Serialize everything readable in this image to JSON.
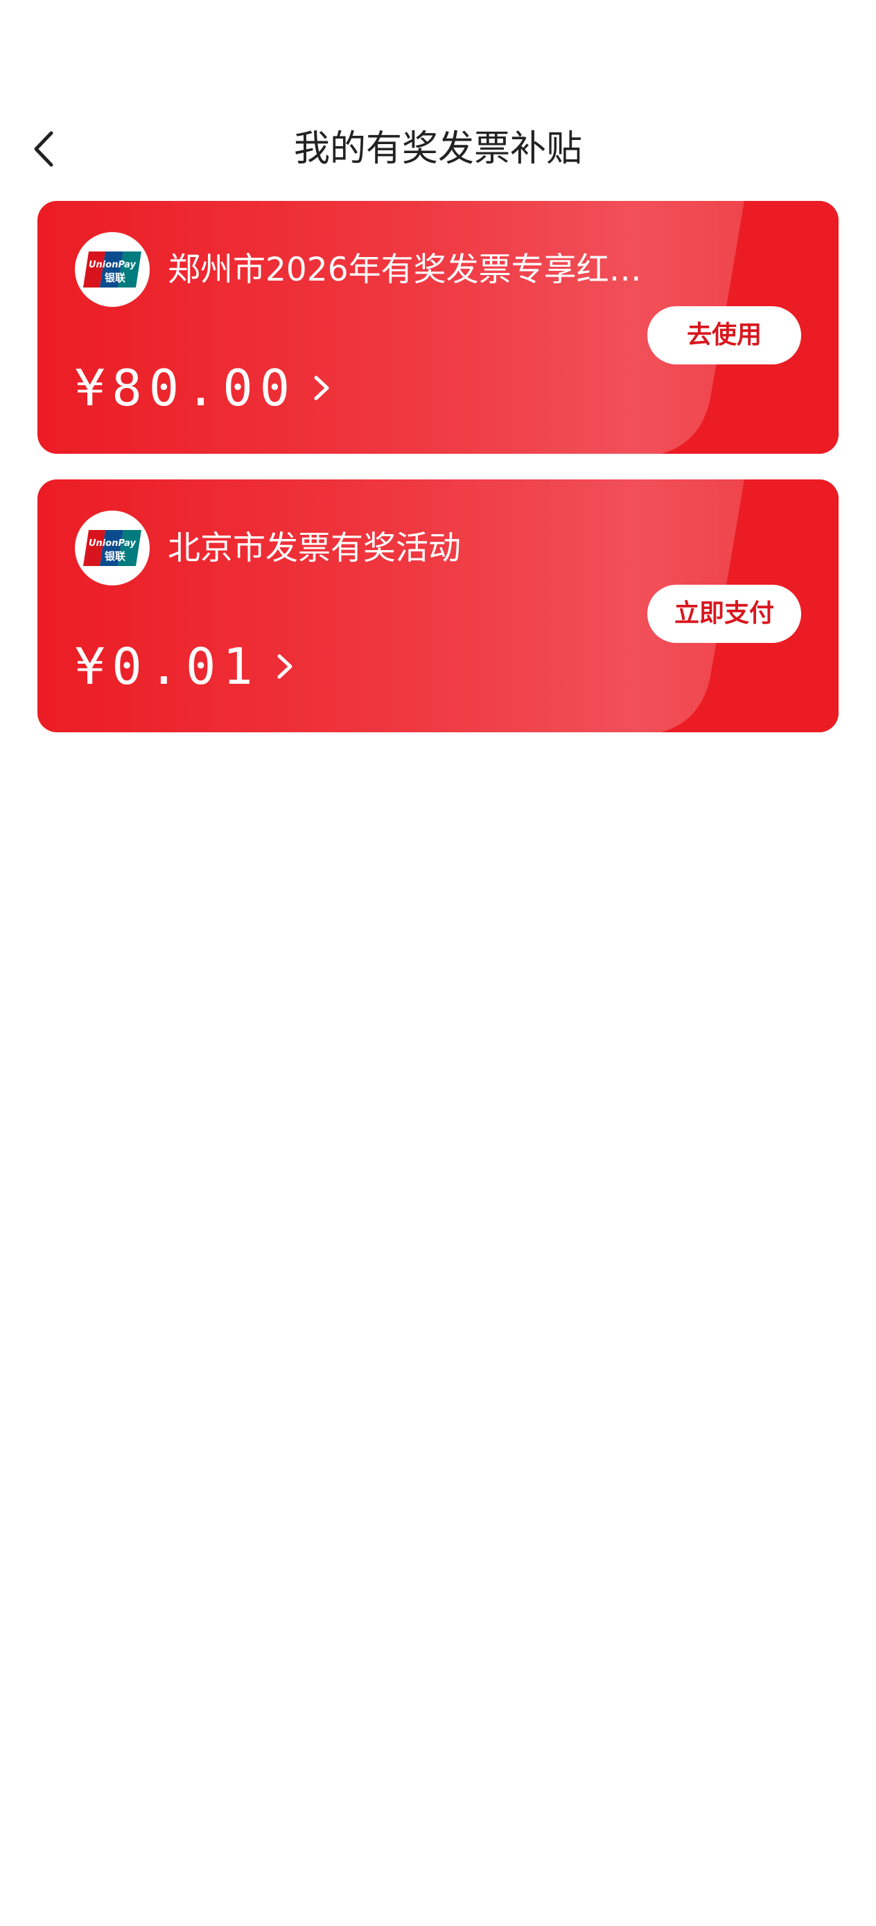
{
  "header": {
    "title": "我的有奖发票补贴"
  },
  "colors": {
    "card_red": "#ec1c24",
    "button_text": "#d8161e",
    "title_text": "#222222"
  },
  "cards": [
    {
      "logo_icon": "unionpay-logo-icon",
      "logo_text_en": "UnionPay",
      "logo_text_cn": "银联",
      "title": "郑州市2026年有奖发票专享红…",
      "amount": "¥80.00",
      "action_label": "去使用"
    },
    {
      "logo_icon": "unionpay-logo-icon",
      "logo_text_en": "UnionPay",
      "logo_text_cn": "银联",
      "title": "北京市发票有奖活动",
      "amount": "¥0.01",
      "action_label": "立即支付"
    }
  ]
}
